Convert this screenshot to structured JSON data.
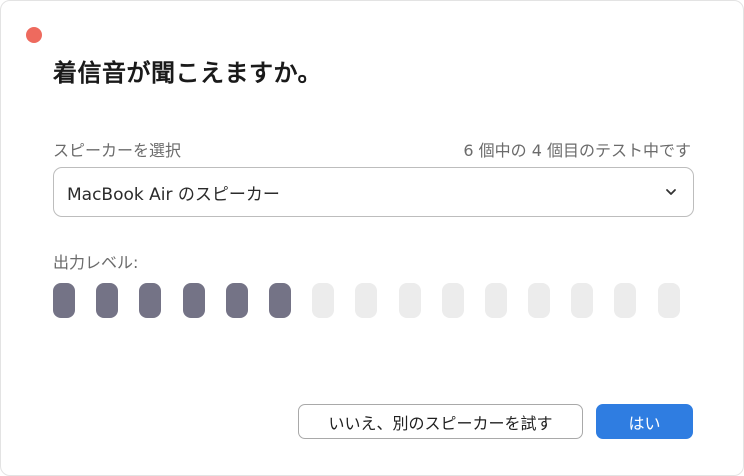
{
  "dialog": {
    "title": "着信音が聞こえますか。",
    "speaker_label": "スピーカーを選択",
    "test_status": "6 個中の 4 個目のテスト中です",
    "selected_speaker": "MacBook Air のスピーカー",
    "output_level_label": "出力レベル:",
    "output_level": {
      "active_segments": 6,
      "total_segments": 15
    },
    "no_button_label": "いいえ、別のスピーカーを試す",
    "yes_button_label": "はい"
  },
  "colors": {
    "close_dot": "#ee6a5e",
    "meter_active": "#747386",
    "meter_inactive": "#ececec",
    "accent": "#2f7de1"
  },
  "icons": {
    "close": "close-icon",
    "dropdown": "chevron-down-icon"
  }
}
